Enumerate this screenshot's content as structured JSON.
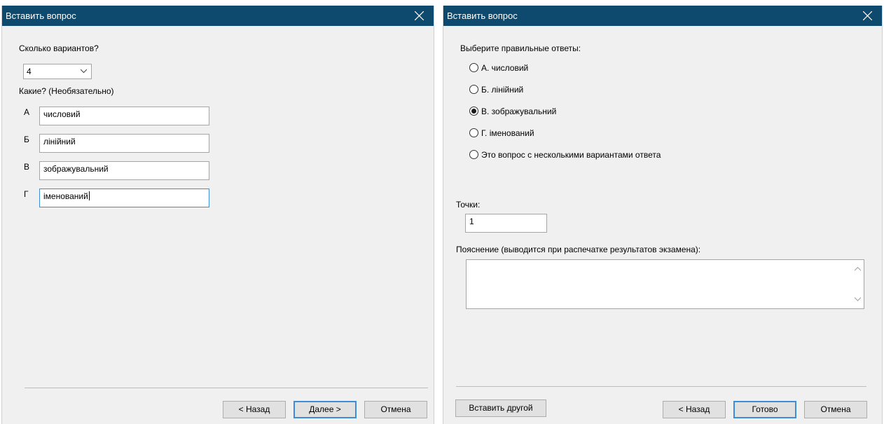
{
  "dialog1": {
    "title": "Вставить вопрос",
    "count_label": "Сколько вариантов?",
    "count_value": "4",
    "which_label": "Какие? (Необязательно)",
    "options": [
      {
        "letter": "А",
        "value": "числовий"
      },
      {
        "letter": "Б",
        "value": "лінійний"
      },
      {
        "letter": "В",
        "value": "зображувальний"
      },
      {
        "letter": "Г",
        "value": "іменований"
      }
    ],
    "buttons": {
      "back": "< Назад",
      "next": "Далее >",
      "cancel": "Отмена"
    }
  },
  "dialog2": {
    "title": "Вставить вопрос",
    "correct_label": "Выберите правильные ответы:",
    "answers": [
      {
        "text": "А.  числовий",
        "selected": false
      },
      {
        "text": "Б.  лінійний",
        "selected": false
      },
      {
        "text": "В.  зображувальний",
        "selected": true
      },
      {
        "text": "Г.  іменований",
        "selected": false
      },
      {
        "text": "Это вопрос с несколькими вариантами ответа",
        "selected": false
      }
    ],
    "points_label": "Точки:",
    "points_value": "1",
    "explanation_label": "Пояснение (выводится при распечатке результатов экзамена):",
    "explanation_value": "",
    "buttons": {
      "insert_other": "Вставить другой",
      "back": "< Назад",
      "finish": "Готово",
      "cancel": "Отмена"
    }
  },
  "colors": {
    "titlebar": "#0e4a6e",
    "dialog_bg": "#f0f0f0",
    "focus": "#3c8fd6"
  },
  "icons": [
    "close-icon",
    "chevron-down-icon",
    "scroll-up-icon",
    "scroll-down-icon",
    "radio-button"
  ]
}
